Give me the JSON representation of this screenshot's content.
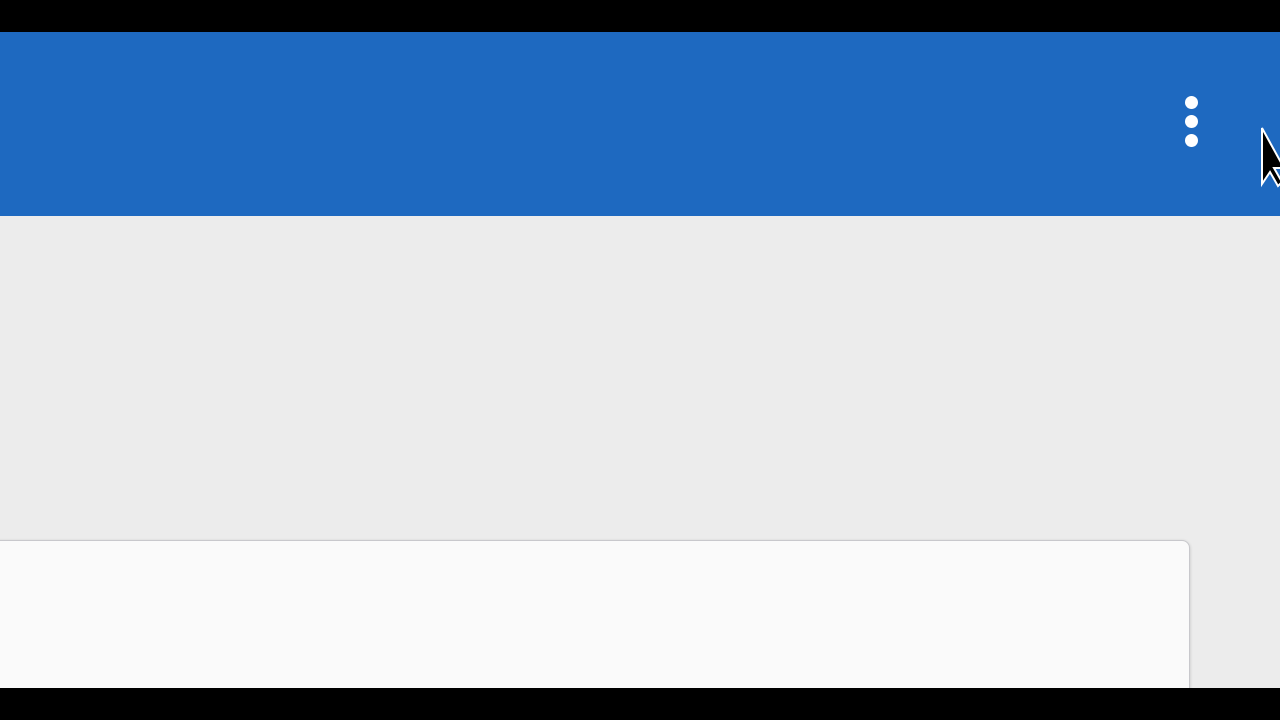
{
  "app_bar": {
    "color": "#1e69c0",
    "overflow_menu_icon": "more-vert-icon"
  },
  "content": {
    "background": "#ececec"
  },
  "card": {
    "background": "#fafafa"
  },
  "cursor": {
    "icon": "mouse-pointer-icon"
  }
}
